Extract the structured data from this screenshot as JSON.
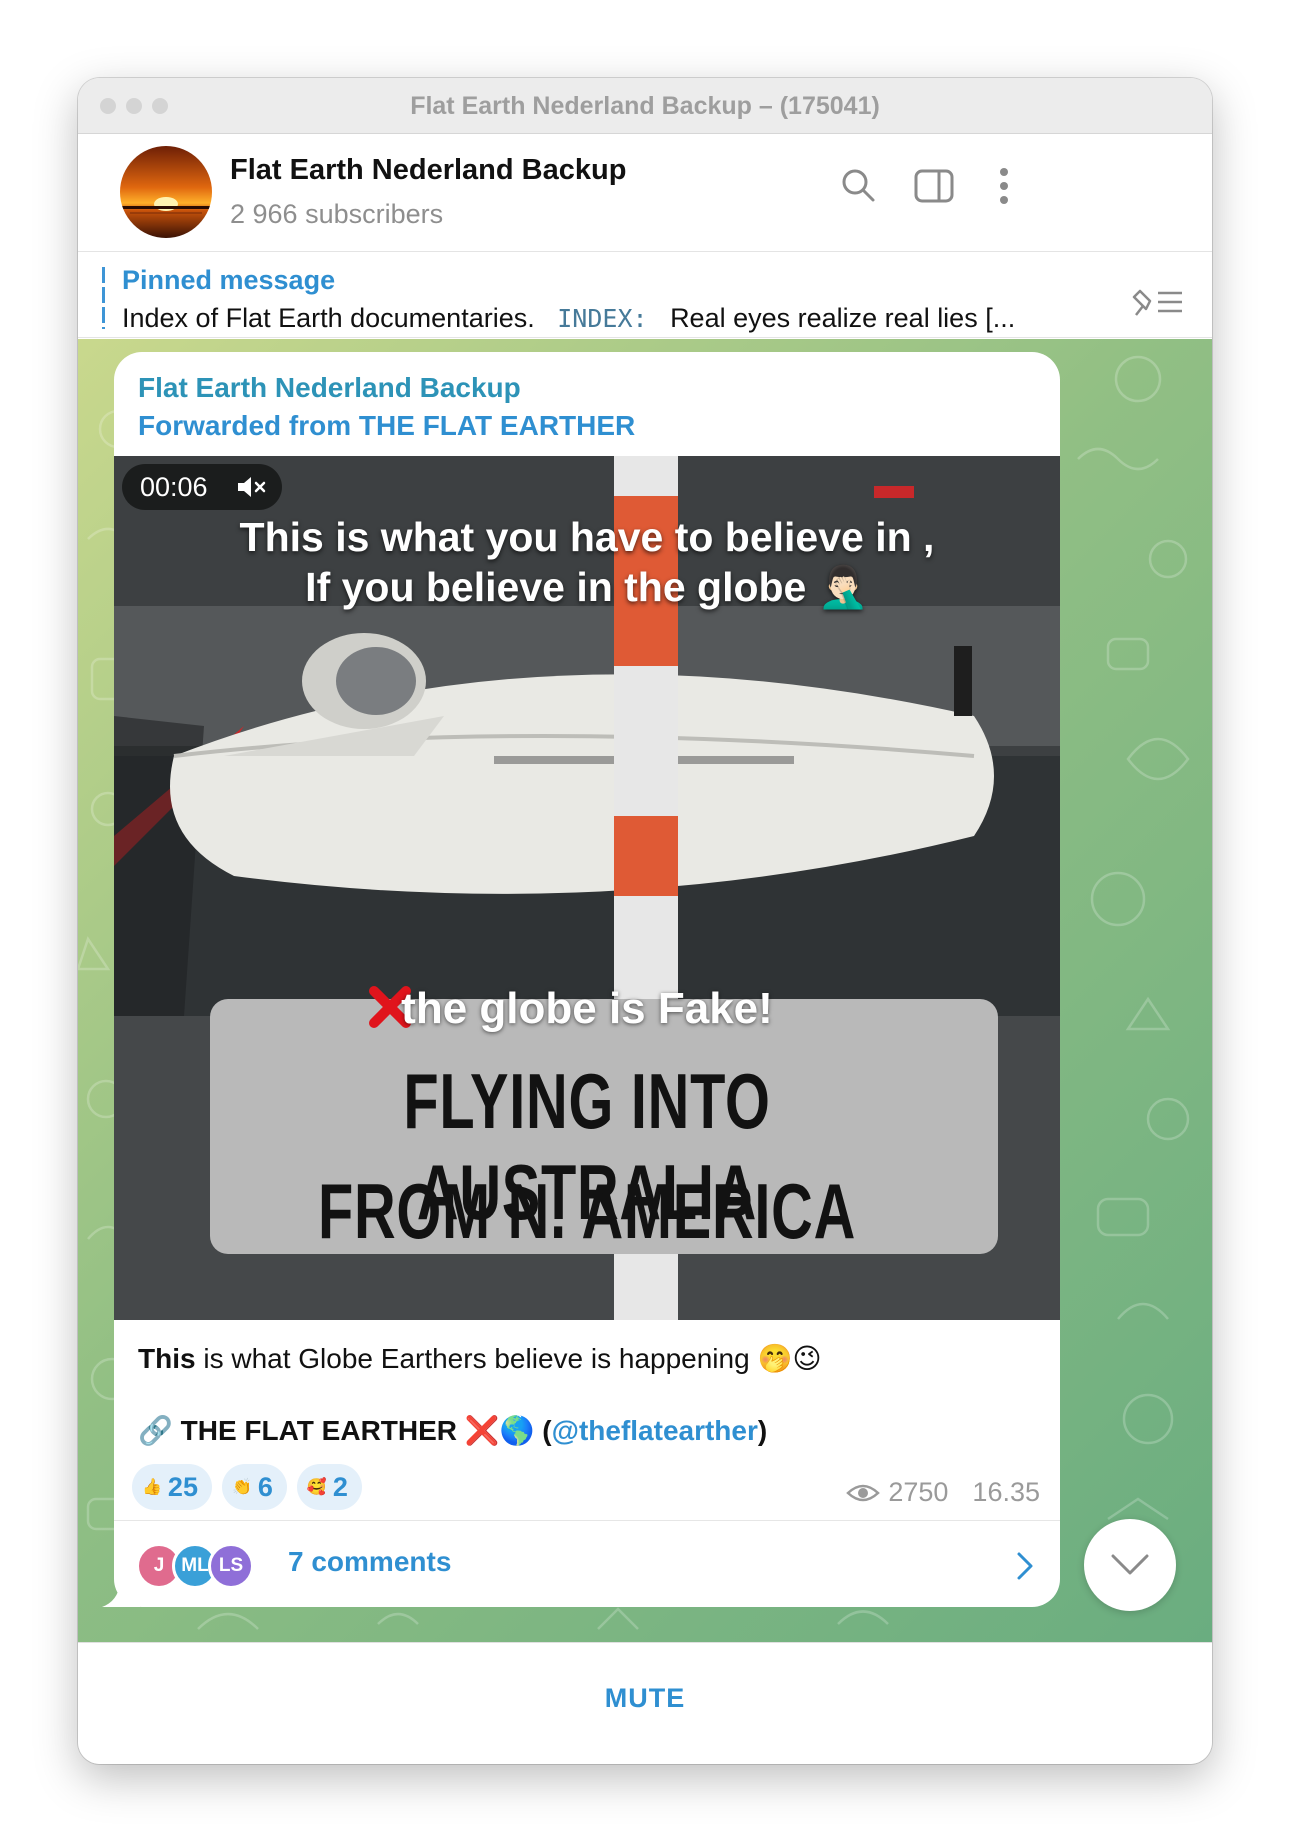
{
  "window": {
    "title": "Flat Earth Nederland Backup – (175041)"
  },
  "header": {
    "channel_name": "Flat Earth Nederland Backup",
    "subscribers": "2 966 subscribers"
  },
  "pinned": {
    "title": "Pinned message",
    "text_before": "Index of Flat Earth documentaries.",
    "code": "INDEX:",
    "text_after": "Real eyes realize real lies  [..."
  },
  "message": {
    "author": "Flat Earth Nederland Backup",
    "forwarded": "Forwarded from THE FLAT EARTHER",
    "video": {
      "duration": "00:06",
      "overlay_line1": "This is what you have to believe in ,",
      "overlay_line2": "If you believe in the globe 🤦🏻‍♂️",
      "banner_line0": "the globe is Fake!",
      "banner_line1": "FLYING INTO AUSTRALIA",
      "banner_line2": "FROM N. AMERICA"
    },
    "caption_bold": "This",
    "caption_rest": " is what Globe Earthers believe is happening 🤭😉",
    "credit_icon": "🔗",
    "credit_name": "THE FLAT EARTHER",
    "credit_emoji": "❌🌎",
    "credit_link": "@theflatearther",
    "reactions": [
      {
        "emoji": "👍",
        "count": "25"
      },
      {
        "emoji": "👏",
        "count": "6"
      },
      {
        "emoji": "🥰",
        "count": "2"
      }
    ],
    "views": "2750",
    "time": "16.35",
    "comments": {
      "label": "7 comments",
      "avatars": [
        "J",
        "ML",
        "LS"
      ]
    }
  },
  "bottom": {
    "mute_label": "MUTE"
  },
  "colors": {
    "accent": "#2f8fd1",
    "channel_name": "#2d93b7",
    "reaction_bg": "#e4f0fa"
  },
  "icons": [
    "search-icon",
    "sidebar-toggle-icon",
    "more-vert-icon",
    "unpin-list-icon",
    "mute-speaker-icon",
    "eye-icon",
    "chevron-right-icon",
    "chevron-down-icon"
  ]
}
